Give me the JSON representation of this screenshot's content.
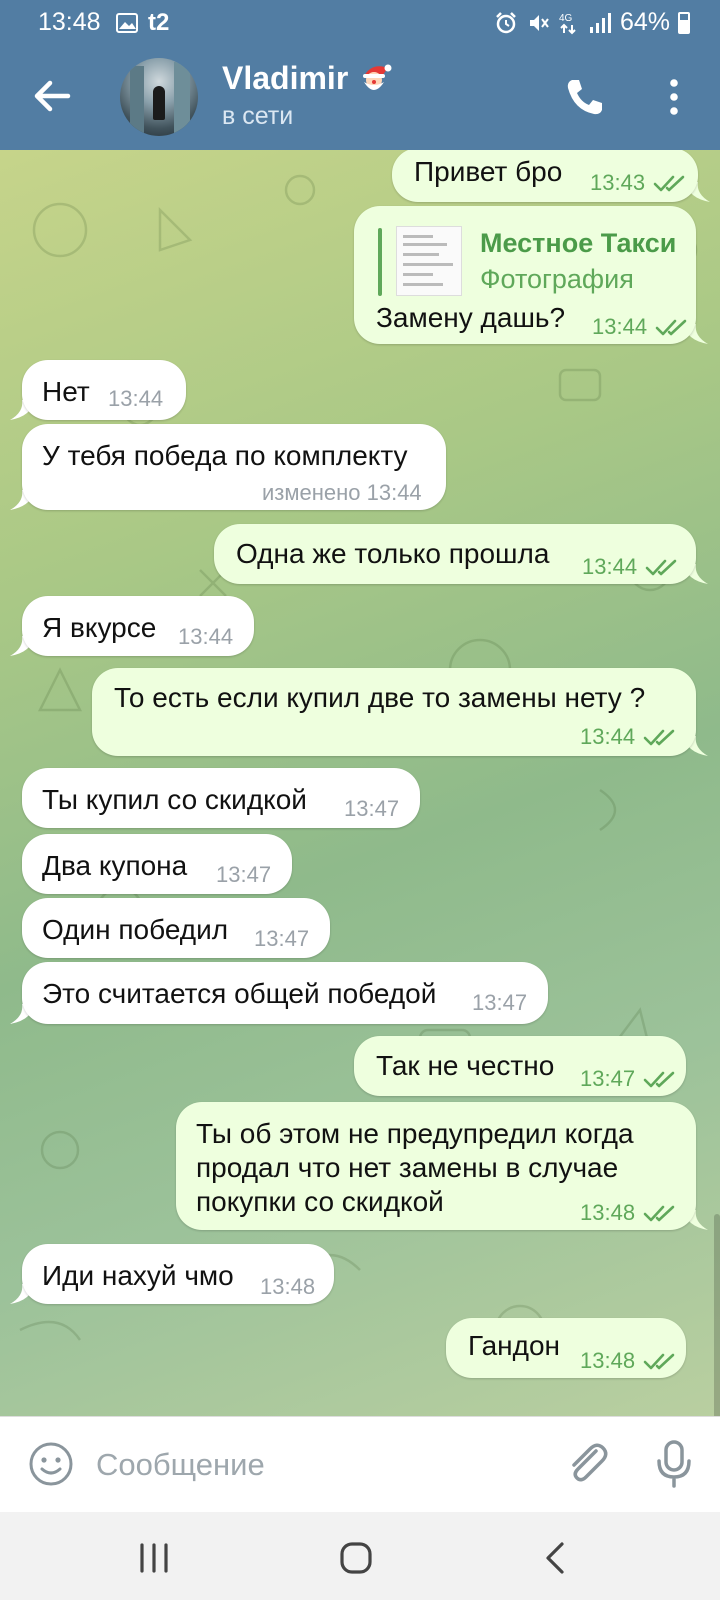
{
  "status_bar": {
    "time": "13:48",
    "carrier": "t2",
    "battery": "64%"
  },
  "header": {
    "back_label": "back",
    "contact_name": "Vladimir",
    "contact_status": "в сети"
  },
  "messages": [
    {
      "dir": "out",
      "text": "Привет бро",
      "time": "13:43",
      "read": true
    },
    {
      "dir": "out",
      "reply_title": "Местное Такси",
      "reply_subtitle": "Фотография",
      "text": "Замену дашь?",
      "time": "13:44",
      "read": true
    },
    {
      "dir": "in",
      "text": "Нет",
      "time": "13:44"
    },
    {
      "dir": "in",
      "text": "У тебя победа по комплекту",
      "time": "изменено 13:44"
    },
    {
      "dir": "out",
      "text": "Одна же только прошла",
      "time": "13:44",
      "read": true
    },
    {
      "dir": "in",
      "text": "Я вкурсе",
      "time": "13:44"
    },
    {
      "dir": "out",
      "text": "То есть если купил две то замены нету ?",
      "time": "13:44",
      "read": true
    },
    {
      "dir": "in",
      "text": "Ты купил со скидкой",
      "time": "13:47"
    },
    {
      "dir": "in",
      "text": "Два купона",
      "time": "13:47"
    },
    {
      "dir": "in",
      "text": "Один победил",
      "time": "13:47"
    },
    {
      "dir": "in",
      "text": "Это считается общей победой",
      "time": "13:47"
    },
    {
      "dir": "out",
      "text": "Так не честно",
      "time": "13:47",
      "read": true
    },
    {
      "dir": "out",
      "lines": [
        "Ты об этом не предупредил когда",
        "продал что нет замены в случае",
        "покупки со скидкой"
      ],
      "time": "13:48",
      "read": true
    },
    {
      "dir": "in",
      "text": "Иди нахуй чмо",
      "time": "13:48"
    },
    {
      "dir": "out",
      "text": "Гандон",
      "time": "13:48",
      "read": true
    }
  ],
  "composer": {
    "placeholder": "Сообщение"
  },
  "colors": {
    "header": "#527da3",
    "out_bubble": "#eeffde",
    "in_bubble": "#ffffff",
    "out_meta": "#5fa85a",
    "in_meta": "#9aa1a8"
  }
}
